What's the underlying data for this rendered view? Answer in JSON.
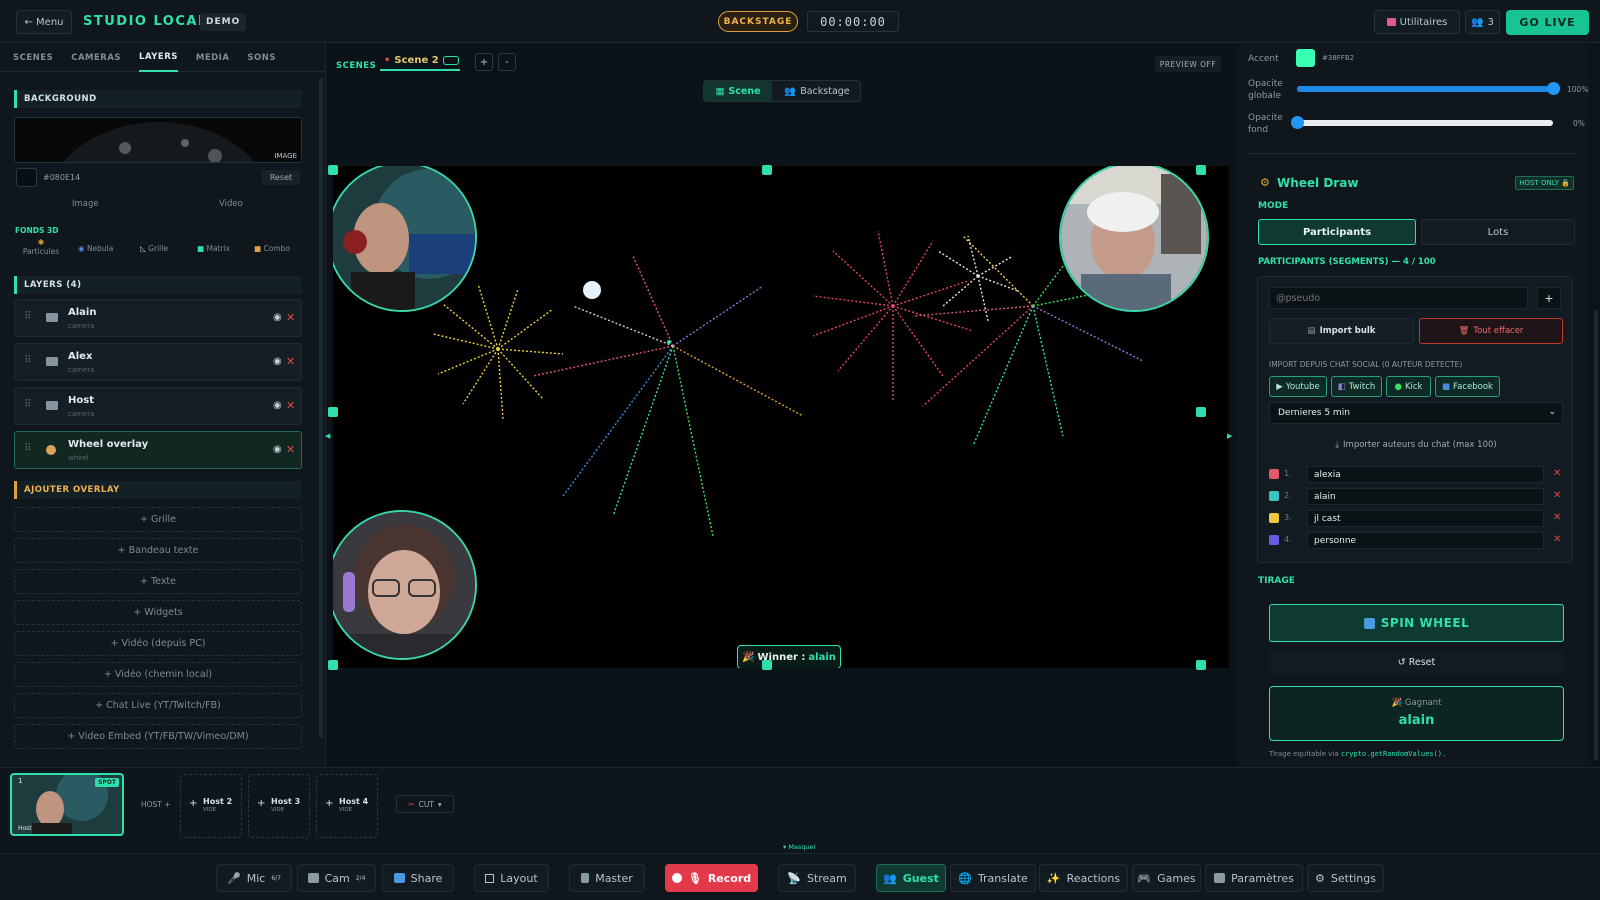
{
  "topbar": {
    "menu": "← Menu",
    "brand": "STUDIO LOCAL",
    "demo": "DEMO",
    "backstage": "BACKSTAGE",
    "timer": "00:00:00",
    "utilities": "Utilitaires",
    "guests_count": "3",
    "go_live": "GO LIVE"
  },
  "left": {
    "tabs": [
      "SCENES",
      "CAMERAS",
      "LAYERS",
      "MEDIA",
      "SONS"
    ],
    "active_tab": "LAYERS",
    "background_title": "BACKGROUND",
    "image_badge": "IMAGE",
    "bg_color": "#080E14",
    "reset": "Reset",
    "image_label": "Image",
    "video_label": "Video",
    "fonds_title": "FONDS 3D",
    "fonds": [
      "Particules",
      "Nebula",
      "Grille",
      "Matrix",
      "Combo"
    ],
    "layers_title": "LAYERS (4)",
    "layers": [
      {
        "name": "Alain",
        "sub": "camera"
      },
      {
        "name": "Alex",
        "sub": "camera"
      },
      {
        "name": "Host",
        "sub": "camera"
      },
      {
        "name": "Wheel overlay",
        "sub": "wheel"
      }
    ],
    "overlay_title": "AJOUTER OVERLAY",
    "overlays": [
      "+ Grille",
      "+ Bandeau texte",
      "+ Texte",
      "+ Widgets",
      "+ Vidéo (depuis PC)",
      "+ Vidéo (chemin local)",
      "+ Chat Live (YT/Twitch/FB)",
      "+ Video Embed (YT/FB/TW/Vimeo/DM)"
    ]
  },
  "stage": {
    "scenes_label": "SCENES",
    "scene_name": "Scene 2",
    "plus": "+",
    "minus": "-",
    "preview": "PREVIEW OFF",
    "toggle_scene": "Scene",
    "toggle_backstage": "Backstage",
    "winner_label": "Winner :",
    "winner_name": "alain"
  },
  "right": {
    "accent_label": "Accent",
    "accent_hex": "#38FFB2",
    "accent_color": "#38ffb2",
    "opacity_global_label1": "Opacite",
    "opacity_global_label2": "globale",
    "opacity_global_value": "100%",
    "opacity_global_level": 1.0,
    "opacity_bg_label1": "Opacite",
    "opacity_bg_label2": "fond",
    "opacity_bg_value": "0%",
    "opacity_bg_level": 0.0,
    "wheel_title": "Wheel Draw",
    "host_only": "HOST ONLY",
    "mode_title": "MODE",
    "mode_participants": "Participants",
    "mode_lots": "Lots",
    "participants_title": "PARTICIPANTS (SEGMENTS) — 4 / 100",
    "pseudo_placeholder": "@pseudo",
    "add": "+",
    "import_bulk": "Import bulk",
    "clear_all": "Tout effacer",
    "import_chat_title": "IMPORT DEPUIS CHAT SOCIAL (0 AUTEUR DETECTE)",
    "platforms": [
      "Youtube",
      "Twitch",
      "Kick",
      "Facebook"
    ],
    "timeframe": "Dernieres 5 min",
    "import_authors": "Importer auteurs du chat (max 100)",
    "participants": [
      {
        "n": "1.",
        "name": "alexia",
        "color": "#e05a6a"
      },
      {
        "n": "2.",
        "name": "alain",
        "color": "#3fc0c0"
      },
      {
        "n": "3.",
        "name": "jl cast",
        "color": "#f0c840"
      },
      {
        "n": "4.",
        "name": "personne",
        "color": "#6a5ae0"
      }
    ],
    "tirage_title": "TIRAGE",
    "spin": "SPIN WHEEL",
    "reset": "↺ Reset",
    "winner_label": "Gagnant",
    "winner_name": "alain",
    "footnote": "Tirage equitable via",
    "footnote_code": "crypto.getRandomValues()."
  },
  "filmstrip": {
    "slot1_num": "1",
    "slot1_badge": "SPOT",
    "slot1_label": "Host",
    "host_label": "HOST +",
    "slots": [
      {
        "title": "Host 2",
        "sub": "VIDE"
      },
      {
        "title": "Host 3",
        "sub": "VIDE"
      },
      {
        "title": "Host 4",
        "sub": "VIDE"
      }
    ],
    "cut": "CUT",
    "masquer": "▾ Masquer"
  },
  "dock": {
    "mic": "Mic",
    "mic_count": "6/7",
    "cam": "Cam",
    "cam_count": "2/4",
    "share": "Share",
    "layout": "Layout",
    "master": "Master",
    "record": "Record",
    "stream": "Stream",
    "guest": "Guest",
    "translate": "Translate",
    "reactions": "Reactions",
    "games": "Games",
    "parametres": "Paramètres",
    "settings": "Settings"
  }
}
